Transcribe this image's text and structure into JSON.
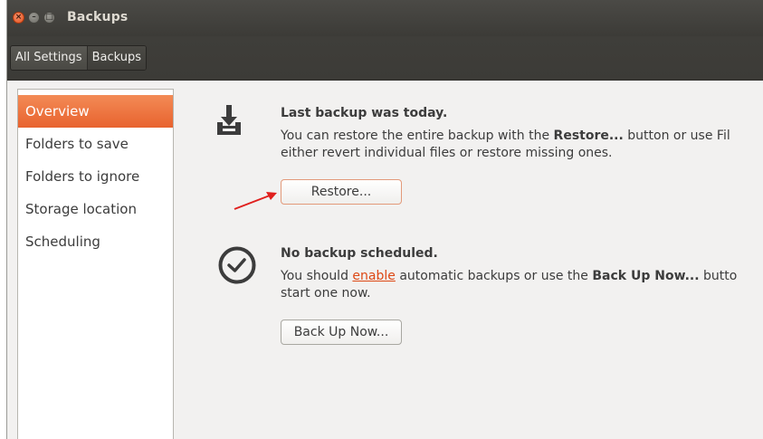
{
  "window": {
    "title": "Backups",
    "close_glyph": "×",
    "min_glyph": "–",
    "max_glyph": "□"
  },
  "breadcrumbs": [
    {
      "label": "All Settings"
    },
    {
      "label": "Backups"
    }
  ],
  "sidebar": {
    "items": [
      {
        "label": "Overview",
        "selected": true
      },
      {
        "label": "Folders to save",
        "selected": false
      },
      {
        "label": "Folders to ignore",
        "selected": false
      },
      {
        "label": "Storage location",
        "selected": false
      },
      {
        "label": "Scheduling",
        "selected": false
      }
    ]
  },
  "backup_status": {
    "icon": "download-tray-icon",
    "heading": "Last backup was today.",
    "line1_pre": "You can restore the entire backup with the ",
    "line1_bold": "Restore...",
    "line1_post": " button or use Fil",
    "line2": "either revert individual files or restore missing ones.",
    "restore_button": "Restore..."
  },
  "schedule_status": {
    "icon": "clock-icon",
    "heading": "No backup scheduled.",
    "line1_pre": "You should ",
    "line1_link": "enable",
    "line1_mid": " automatic backups or use the ",
    "line1_bold": "Back Up Now...",
    "line1_post": " butto",
    "line2": "start one now.",
    "backup_now_button": "Back Up Now..."
  },
  "annotation": {
    "icon": "red-arrow-icon",
    "color": "#e0201e"
  },
  "colors": {
    "accent": "#e8622e",
    "link": "#dd4814",
    "titlebar": "#3c3b37"
  }
}
